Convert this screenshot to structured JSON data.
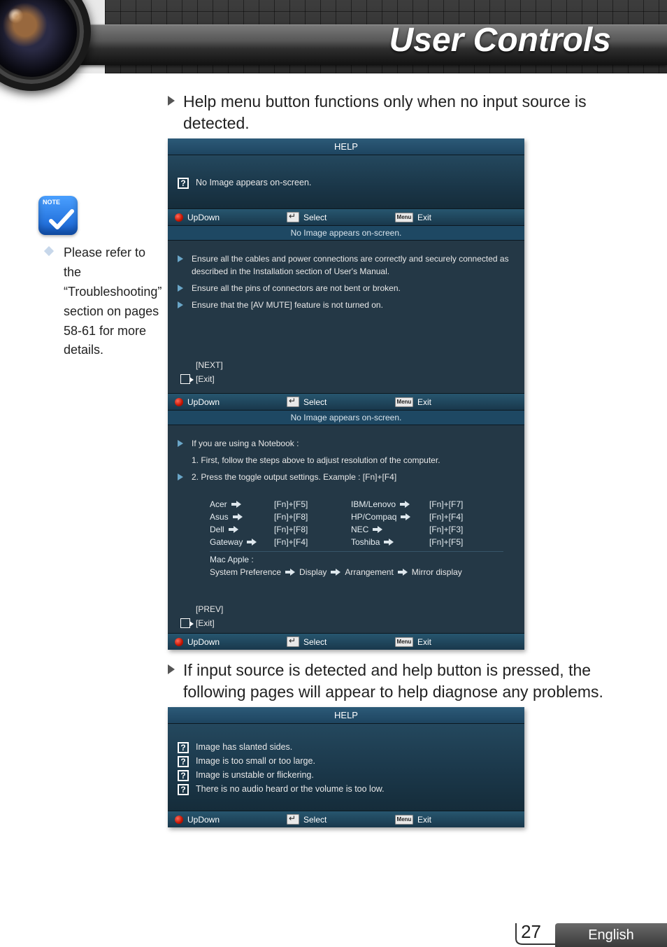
{
  "header": {
    "title": "User Controls"
  },
  "bullets": {
    "b1": "Help menu button functions only when no input source is detected.",
    "b2": "If input source is detected and help button is pressed, the following pages will appear to help diagnose any problems."
  },
  "note": {
    "label": "Note",
    "text": "Please refer to the “Troubleshooting” section on pages 58-61 for more details."
  },
  "osd": {
    "help_title": "HELP",
    "foot": {
      "updown": "UpDown",
      "select": "Select",
      "exit": "Exit",
      "menu": "Menu"
    },
    "panel1": {
      "item": "No Image appears on-screen.",
      "sub": "No Image appears on-screen.",
      "lines": [
        "Ensure all the cables and power connections are correctly and securely connected as described in the Installation section of User's Manual.",
        "Ensure all the pins of connectors are not bent or broken.",
        "Ensure that the [AV MUTE] feature is not turned on."
      ],
      "nav": {
        "next": "[NEXT]",
        "exit": "[Exit]"
      }
    },
    "panel2": {
      "sub": "No Image appears on-screen.",
      "l1": "If you are using a Notebook :",
      "l2": "1. First, follow the steps above to adjust resolution of the computer.",
      "l3": "2. Press the toggle output settings. Example : [Fn]+[F4]",
      "brands": [
        {
          "name": "Acer",
          "key": "[Fn]+[F5]"
        },
        {
          "name": "Asus",
          "key": "[Fn]+[F8]"
        },
        {
          "name": "Dell",
          "key": "[Fn]+[F8]"
        },
        {
          "name": "Gateway",
          "key": "[Fn]+[F4]"
        }
      ],
      "brands_r": [
        {
          "name": "IBM/Lenovo",
          "key": "[Fn]+[F7]"
        },
        {
          "name": "HP/Compaq",
          "key": "[Fn]+[F4]"
        },
        {
          "name": "NEC",
          "key": "[Fn]+[F3]"
        },
        {
          "name": "Toshiba",
          "key": "[Fn]+[F5]"
        }
      ],
      "mac_label": "Mac Apple :",
      "mac_path": [
        "System Preference",
        "Display",
        "Arrangement",
        "Mirror display"
      ],
      "nav": {
        "prev": "[PREV]",
        "exit": "[Exit]"
      }
    },
    "panel3": {
      "items": [
        "Image has slanted sides.",
        "Image is too small or too large.",
        "Image is unstable or flickering.",
        "There is no audio heard or the volume is too low."
      ]
    }
  },
  "footer": {
    "page": "27",
    "lang": "English"
  }
}
